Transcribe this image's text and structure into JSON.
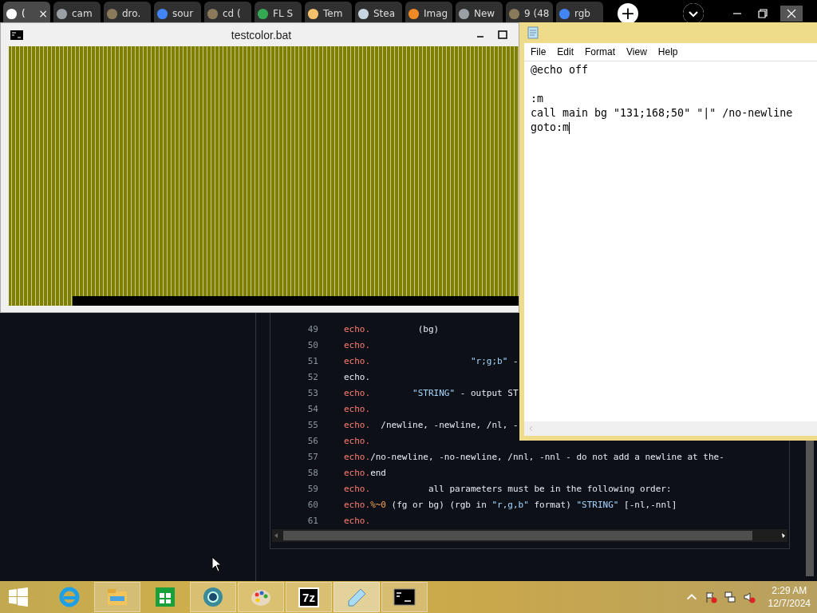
{
  "browser": {
    "tabs": [
      {
        "title": "(",
        "selected": true
      },
      {
        "title": "cam",
        "selected": false
      },
      {
        "title": "dro.",
        "selected": false
      },
      {
        "title": "sour",
        "selected": false
      },
      {
        "title": "cd (",
        "selected": false
      },
      {
        "title": "FL S",
        "selected": false
      },
      {
        "title": "Tem",
        "selected": false
      },
      {
        "title": "Stea",
        "selected": false
      },
      {
        "title": "Imag",
        "selected": false
      },
      {
        "title": "New",
        "selected": false
      },
      {
        "title": "9 (48",
        "selected": false
      },
      {
        "title": "rgb",
        "selected": false
      }
    ],
    "new_tab": "+",
    "close": "×"
  },
  "editor": {
    "lines": [
      {
        "number": "49",
        "segments": [
          {
            "kind": "keyword",
            "text": "echo."
          },
          {
            "kind": "plain",
            "text": "         (bg)"
          }
        ]
      },
      {
        "number": "50",
        "segments": [
          {
            "kind": "keyword",
            "text": "echo."
          }
        ]
      },
      {
        "number": "51",
        "segments": [
          {
            "kind": "keyword",
            "text": "echo."
          },
          {
            "kind": "string",
            "text": "                   \"r;g;b\""
          },
          {
            "kind": "plain",
            "text": " -"
          }
        ]
      },
      {
        "number": "52",
        "segments": [
          {
            "kind": "plain",
            "text": "echo."
          }
        ]
      },
      {
        "number": "53",
        "segments": [
          {
            "kind": "keyword",
            "text": "echo."
          },
          {
            "kind": "string",
            "text": "        \"STRING\""
          },
          {
            "kind": "plain",
            "text": " - output ST"
          }
        ]
      },
      {
        "number": "54",
        "segments": [
          {
            "kind": "keyword",
            "text": "echo."
          }
        ]
      },
      {
        "number": "55",
        "segments": [
          {
            "kind": "keyword",
            "text": "echo."
          },
          {
            "kind": "plain",
            "text": "  /newline, -newline, /nl, -"
          }
        ]
      },
      {
        "number": "56",
        "segments": [
          {
            "kind": "keyword",
            "text": "echo."
          }
        ]
      },
      {
        "number": "57",
        "segments": [
          {
            "kind": "keyword",
            "text": "echo."
          },
          {
            "kind": "plain",
            "text": "/no-newline, -no-newline, /nnl, -nnl - do not add a newline at the-"
          }
        ]
      },
      {
        "number": "58",
        "segments": [
          {
            "kind": "keyword",
            "text": "echo."
          },
          {
            "kind": "plain",
            "text": "end"
          }
        ]
      },
      {
        "number": "59",
        "segments": [
          {
            "kind": "keyword",
            "text": "echo."
          },
          {
            "kind": "plain",
            "text": "           all parameters must be in the following order:"
          }
        ]
      },
      {
        "number": "60",
        "segments": [
          {
            "kind": "keyword",
            "text": "echo."
          },
          {
            "kind": "variable",
            "text": "%~0"
          },
          {
            "kind": "plain",
            "text": " (fg or bg) (rgb in "
          },
          {
            "kind": "string",
            "text": "\"r,g,b\""
          },
          {
            "kind": "plain",
            "text": " format) "
          },
          {
            "kind": "string",
            "text": "\"STRING\""
          },
          {
            "kind": "plain",
            "text": " [-nl,-nnl]"
          }
        ]
      },
      {
        "number": "61",
        "segments": [
          {
            "kind": "keyword",
            "text": "echo."
          }
        ]
      }
    ]
  },
  "console": {
    "title": "testcolor.bat"
  },
  "notepad": {
    "menu": [
      "File",
      "Edit",
      "Format",
      "View",
      "Help"
    ],
    "content": "@echo off\n\n:m\ncall main bg \"131;168;50\" \"|\" /no-newline\ngoto:m"
  },
  "taskbar": {
    "apps": [
      {
        "kind": "ie",
        "running": false,
        "focused": false
      },
      {
        "kind": "explorer",
        "running": true,
        "focused": false
      },
      {
        "kind": "store",
        "running": false,
        "focused": false
      },
      {
        "kind": "browser",
        "running": true,
        "focused": false
      },
      {
        "kind": "paint",
        "running": true,
        "focused": false
      },
      {
        "kind": "archiver",
        "running": true,
        "focused": false,
        "label": "7z"
      },
      {
        "kind": "notepad",
        "running": true,
        "focused": true
      },
      {
        "kind": "console",
        "running": true,
        "focused": false
      }
    ],
    "time": "2:29 AM",
    "date": "12/7/2024"
  }
}
